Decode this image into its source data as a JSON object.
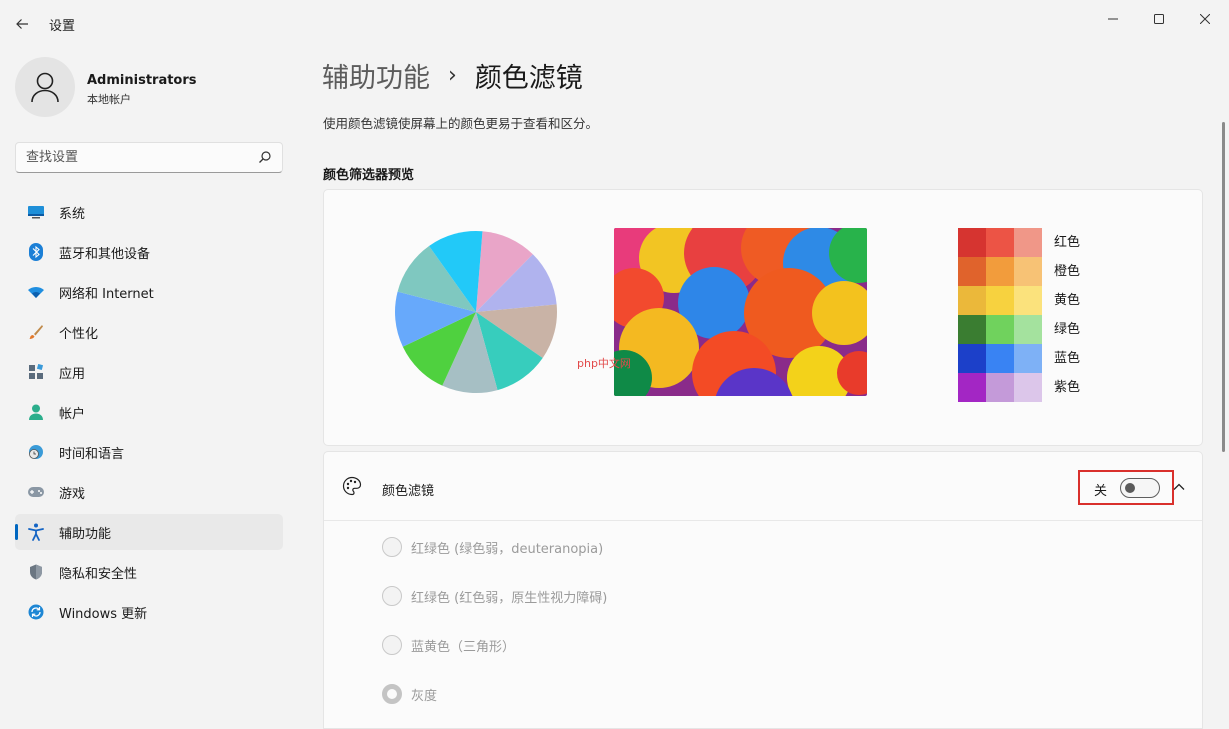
{
  "window": {
    "title": "设置"
  },
  "profile": {
    "name": "Administrators",
    "account_type": "本地帐户"
  },
  "search": {
    "placeholder": "查找设置"
  },
  "sidebar": {
    "items": [
      {
        "label": "系统",
        "icon": "monitor-icon"
      },
      {
        "label": "蓝牙和其他设备",
        "icon": "bluetooth-icon"
      },
      {
        "label": "网络和 Internet",
        "icon": "wifi-icon"
      },
      {
        "label": "个性化",
        "icon": "brush-icon"
      },
      {
        "label": "应用",
        "icon": "apps-icon"
      },
      {
        "label": "帐户",
        "icon": "person-icon"
      },
      {
        "label": "时间和语言",
        "icon": "clock-globe-icon"
      },
      {
        "label": "游戏",
        "icon": "gamepad-icon"
      },
      {
        "label": "辅助功能",
        "icon": "accessibility-icon",
        "active": true
      },
      {
        "label": "隐私和安全性",
        "icon": "shield-icon"
      },
      {
        "label": "Windows 更新",
        "icon": "update-icon"
      }
    ]
  },
  "page": {
    "breadcrumb_parent": "辅助功能",
    "breadcrumb_separator": "›",
    "title": "颜色滤镜",
    "description": "使用颜色滤镜使屏幕上的颜色更易于查看和区分。",
    "preview_title": "颜色筛选器预览"
  },
  "preview": {
    "pie_colors": [
      "#e9a5c8",
      "#b0b3ee",
      "#c9b3a6",
      "#37cdbd",
      "#a6bfc4",
      "#4fd13f",
      "#67a9fb",
      "#7fc8c0",
      "#22c9f8"
    ],
    "swatches": [
      {
        "label": "红色",
        "colors": [
          "#d63430",
          "#ec5445",
          "#f09788"
        ]
      },
      {
        "label": "橙色",
        "colors": [
          "#e0632c",
          "#f29c3c",
          "#f7c275"
        ]
      },
      {
        "label": "黄色",
        "colors": [
          "#ebb83a",
          "#f7d23f",
          "#fbe27c"
        ]
      },
      {
        "label": "绿色",
        "colors": [
          "#3a7d31",
          "#70d25d",
          "#a4e29e"
        ]
      },
      {
        "label": "蓝色",
        "colors": [
          "#1c40c9",
          "#3983f3",
          "#7eb1f6"
        ]
      },
      {
        "label": "紫色",
        "colors": [
          "#a326c4",
          "#c49ad9",
          "#dcc6ea"
        ]
      }
    ],
    "watermark": "php中文网"
  },
  "color_filter": {
    "title": "颜色滤镜",
    "toggle_state": "关",
    "options": [
      {
        "label": "红绿色 (绿色弱，deuteranopia)",
        "checked": false
      },
      {
        "label": "红绿色 (红色弱，原生性视力障碍)",
        "checked": false
      },
      {
        "label": "蓝黄色（三角形）",
        "checked": false
      },
      {
        "label": "灰度",
        "checked": true
      }
    ]
  }
}
